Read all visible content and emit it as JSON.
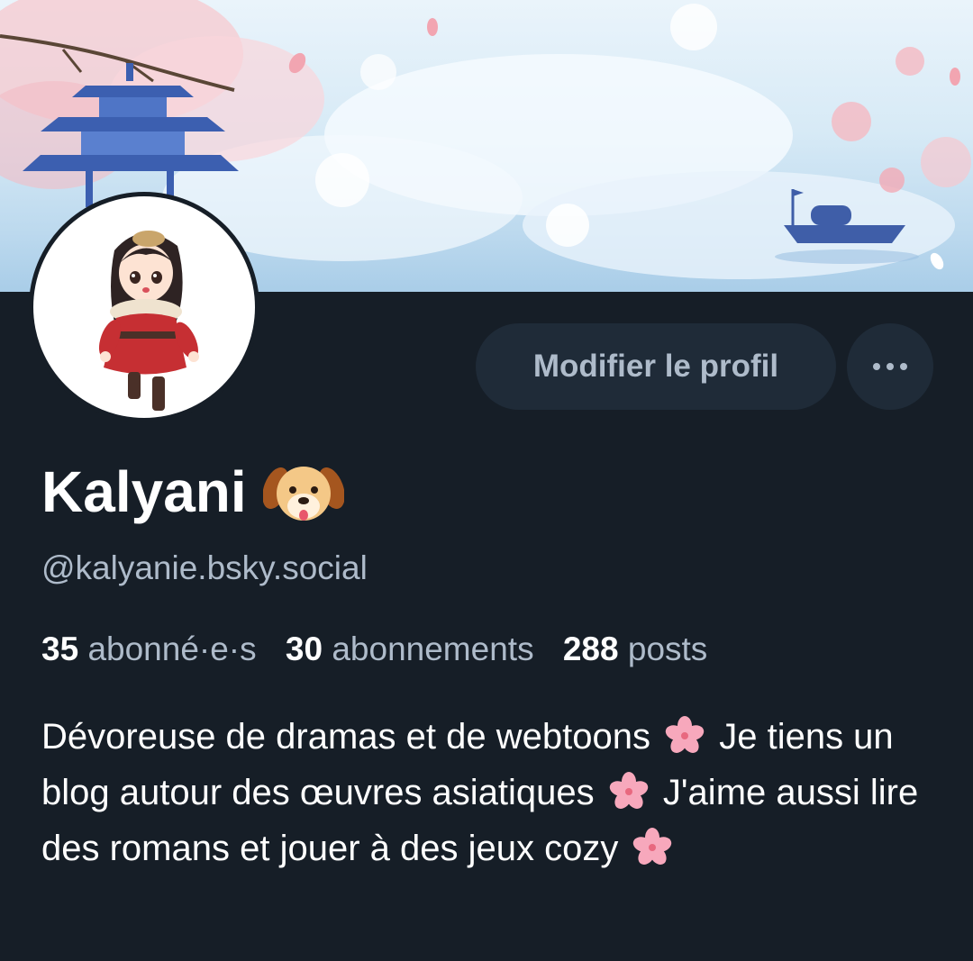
{
  "profile": {
    "display_name": "Kalyani",
    "name_emoji": "dog-face-emoji",
    "handle": "@kalyanie.bsky.social",
    "edit_button_label": "Modifier le profil",
    "more_button_icon": "more-dots-icon",
    "stats": {
      "followers_count": "35",
      "followers_label": "abonné·e·s",
      "following_count": "30",
      "following_label": "abonnements",
      "posts_count": "288",
      "posts_label": "posts"
    },
    "bio": {
      "part1": "Dévoreuse de dramas et de webtoons",
      "part2": "Je tiens un blog autour des œuvres asiatiques",
      "part3": "J'aime aussi lire des romans et jouer à des jeux cozy",
      "separator_icon": "cherry-blossom-icon"
    }
  },
  "colors": {
    "background": "#161e27",
    "button_bg": "#1f2b38",
    "muted_text": "#aebbca",
    "primary_text": "#ffffff"
  }
}
